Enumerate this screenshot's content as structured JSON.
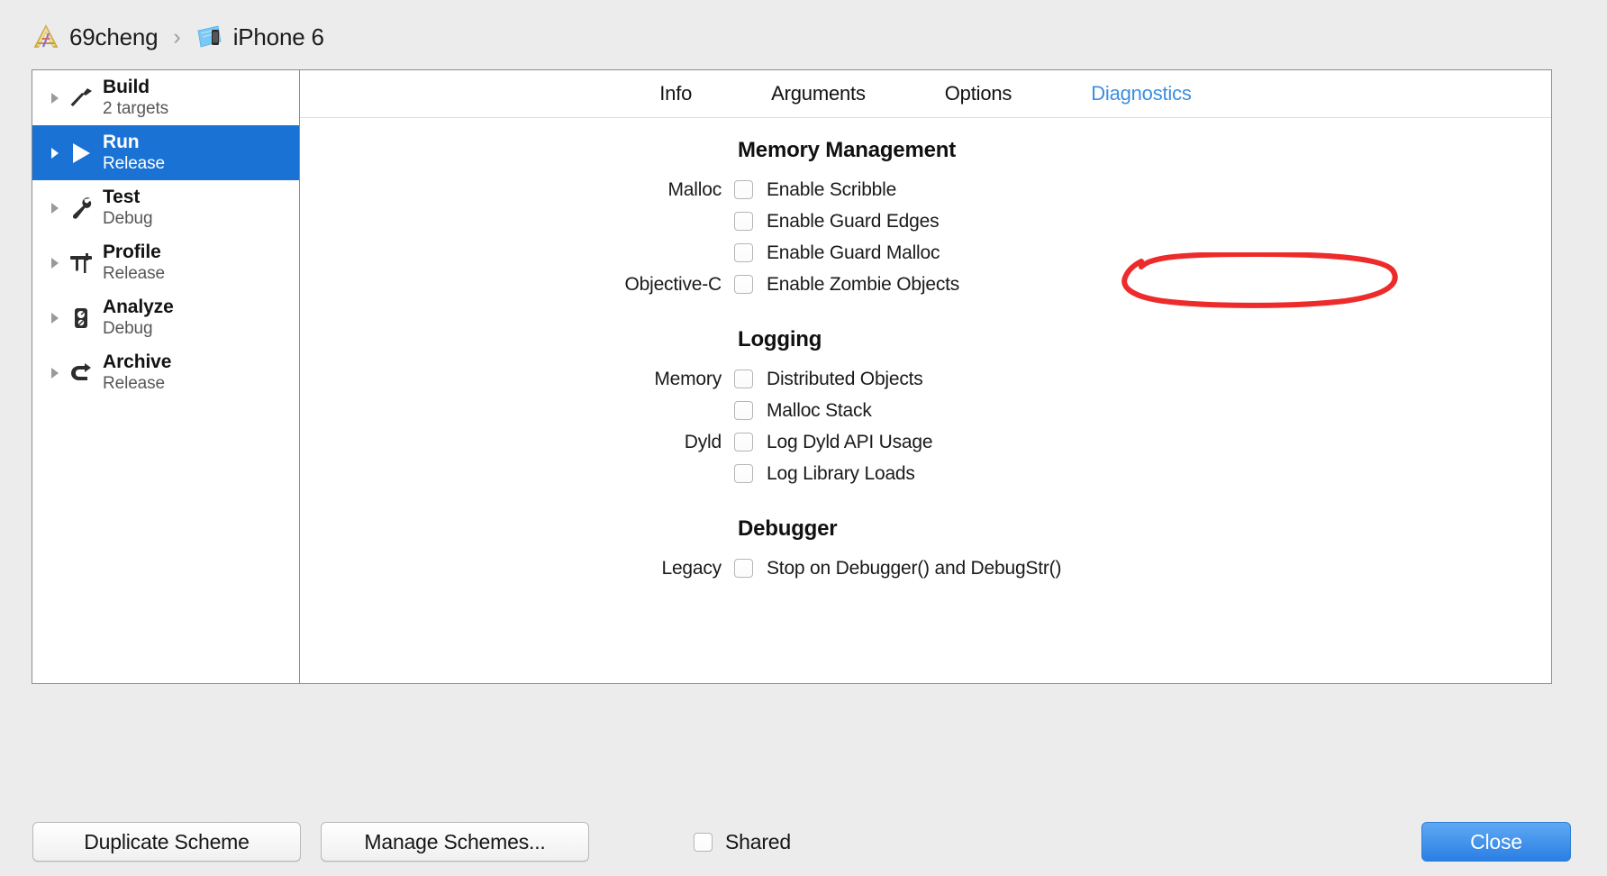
{
  "breadcrumb": {
    "project": {
      "label": "69cheng",
      "icon": "xcode-project-icon"
    },
    "separator": "›",
    "destination": {
      "label": "iPhone 6",
      "icon": "ios-simulator-icon"
    }
  },
  "sidebar": {
    "items": [
      {
        "title": "Build",
        "subtitle": "2 targets",
        "icon": "hammer-icon",
        "selected": false
      },
      {
        "title": "Run",
        "subtitle": "Release",
        "icon": "play-icon",
        "selected": true
      },
      {
        "title": "Test",
        "subtitle": "Debug",
        "icon": "wrench-icon",
        "selected": false
      },
      {
        "title": "Profile",
        "subtitle": "Release",
        "icon": "calipers-icon",
        "selected": false
      },
      {
        "title": "Analyze",
        "subtitle": "Debug",
        "icon": "gauge-icon",
        "selected": false
      },
      {
        "title": "Archive",
        "subtitle": "Release",
        "icon": "archive-icon",
        "selected": false
      }
    ]
  },
  "tabs": [
    {
      "label": "Info",
      "active": false
    },
    {
      "label": "Arguments",
      "active": false
    },
    {
      "label": "Options",
      "active": false
    },
    {
      "label": "Diagnostics",
      "active": true
    }
  ],
  "sections": [
    {
      "heading": "Memory Management",
      "rows": [
        {
          "label": "Malloc",
          "text": "Enable Scribble",
          "checked": false,
          "annotated": false
        },
        {
          "label": "",
          "text": "Enable Guard Edges",
          "checked": false,
          "annotated": false
        },
        {
          "label": "",
          "text": "Enable Guard Malloc",
          "checked": false,
          "annotated": false
        },
        {
          "label": "Objective-C",
          "text": "Enable Zombie Objects",
          "checked": false,
          "annotated": true
        }
      ]
    },
    {
      "heading": "Logging",
      "rows": [
        {
          "label": "Memory",
          "text": "Distributed Objects",
          "checked": false,
          "annotated": false
        },
        {
          "label": "",
          "text": "Malloc Stack",
          "checked": false,
          "annotated": false
        },
        {
          "label": "Dyld",
          "text": "Log Dyld API Usage",
          "checked": false,
          "annotated": false
        },
        {
          "label": "",
          "text": "Log Library Loads",
          "checked": false,
          "annotated": false
        }
      ]
    },
    {
      "heading": "Debugger",
      "rows": [
        {
          "label": "Legacy",
          "text": "Stop on Debugger() and DebugStr()",
          "checked": false,
          "annotated": false
        }
      ]
    }
  ],
  "footer": {
    "duplicate_label": "Duplicate Scheme",
    "manage_label": "Manage Schemes...",
    "shared_label": "Shared",
    "shared_checked": false,
    "close_label": "Close"
  },
  "colors": {
    "selection_blue": "#1a72d4",
    "active_tab_blue": "#3b8ee0",
    "annotation_red": "#ee2b2b",
    "window_bg": "#ffffff",
    "chrome_bg": "#ececec"
  }
}
